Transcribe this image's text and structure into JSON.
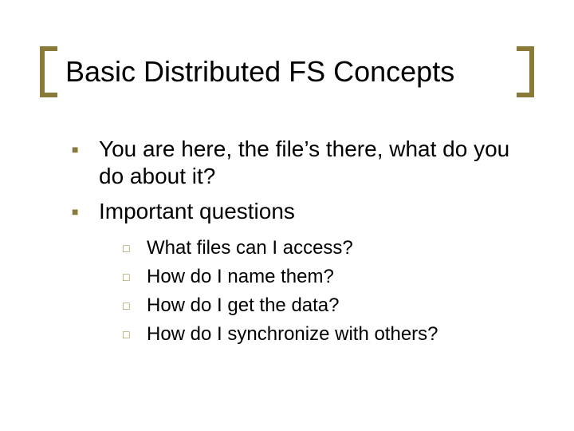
{
  "title": "Basic Distributed FS Concepts",
  "bullets": [
    "You are here, the file’s there, what do you do about it?",
    "Important questions"
  ],
  "sub_bullets": [
    "What files can I access?",
    "How do I name them?",
    "How do I get the data?",
    "How do I synchronize with others?"
  ]
}
